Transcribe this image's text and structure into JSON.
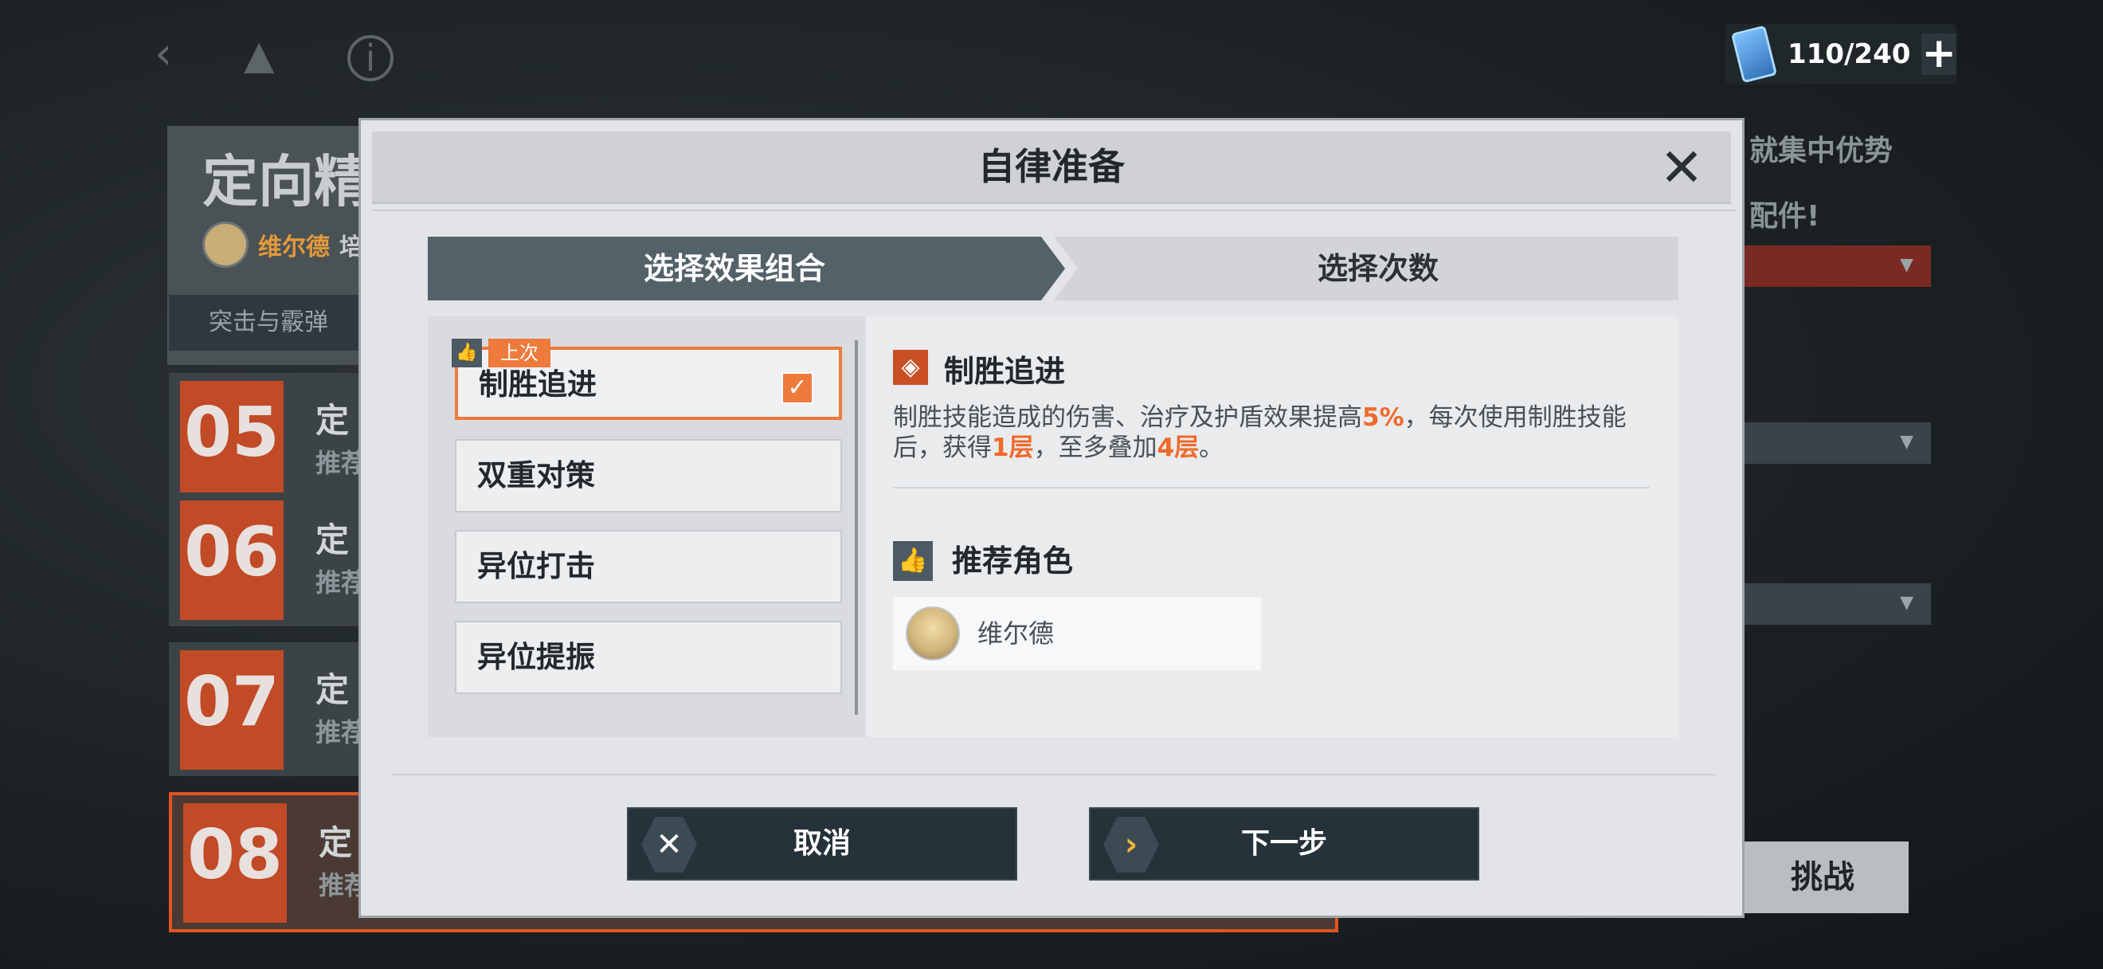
{
  "hud": {
    "stamina": "110/240",
    "stamina_plus": "+"
  },
  "background": {
    "title": "定向精",
    "character_name": "维尔德",
    "character_suffix": "培",
    "tab": "突击与霰弹",
    "stages": [
      {
        "number": "05",
        "title": "定",
        "sub": "推荐"
      },
      {
        "number": "06",
        "title": "定",
        "sub": "推荐"
      },
      {
        "number": "07",
        "title": "定",
        "sub": "推荐"
      },
      {
        "number": "08",
        "title": "定",
        "sub": "推荐"
      }
    ],
    "right_text_1": "就集中优势",
    "right_text_2": "配件!",
    "challenge_label": "挑战"
  },
  "modal": {
    "title": "自律准备",
    "close_icon": "close-icon",
    "steps": {
      "step1": "选择效果组合",
      "step2": "选择次数"
    },
    "options": [
      {
        "label": "制胜追进",
        "selected": true,
        "last_tag": "上次"
      },
      {
        "label": "双重对策"
      },
      {
        "label": "异位打击"
      },
      {
        "label": "异位提振"
      }
    ],
    "detail": {
      "name": "制胜追进",
      "desc_parts": [
        "制胜技能造成的伤害、治疗及护盾效果提高",
        "5%",
        "，每次使用制胜技能后，获得",
        "1层",
        "，至多叠加",
        "4层",
        "。"
      ],
      "rec_title": "推荐角色",
      "rec_character": "维尔德"
    },
    "buttons": {
      "cancel": "取消",
      "next": "下一步"
    }
  },
  "colors": {
    "accent": "#ee7a3c",
    "step_active": "#536169",
    "button_dark": "#25323a"
  }
}
